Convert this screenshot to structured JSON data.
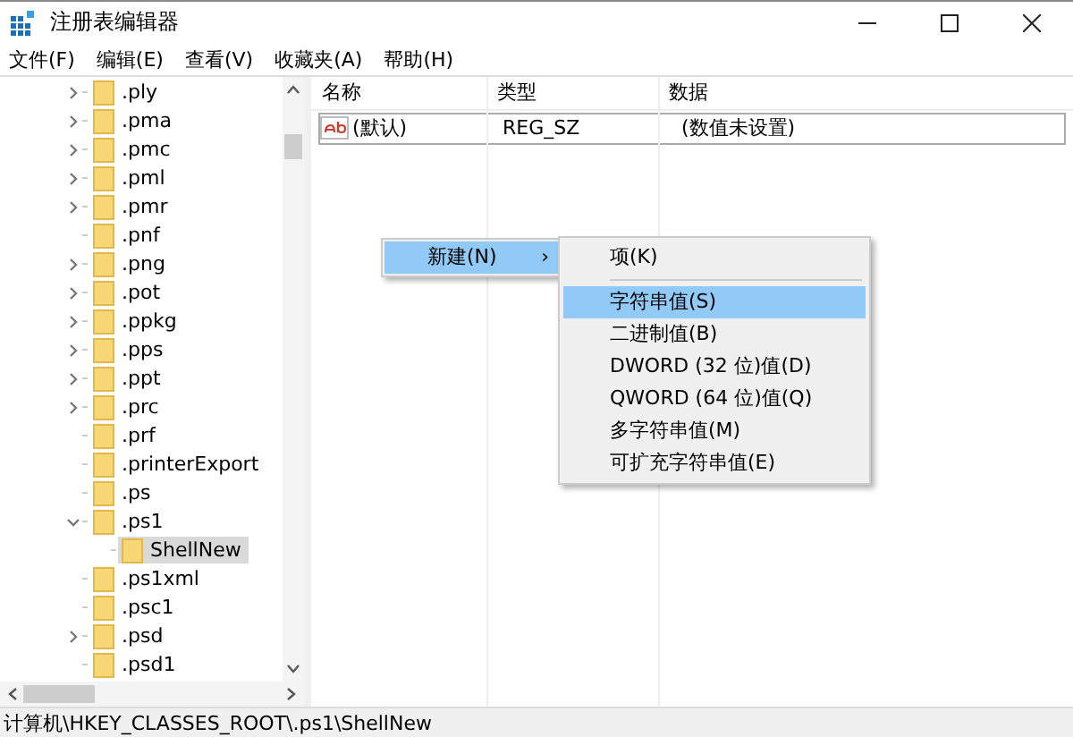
{
  "window": {
    "title": "注册表编辑器"
  },
  "menu": [
    {
      "label": "文件(F)"
    },
    {
      "label": "编辑(E)"
    },
    {
      "label": "查看(V)"
    },
    {
      "label": "收藏夹(A)"
    },
    {
      "label": "帮助(H)"
    }
  ],
  "tree": [
    {
      "label": ".ply",
      "expandable": true,
      "expanded": false,
      "selected": false
    },
    {
      "label": ".pma",
      "expandable": true,
      "expanded": false,
      "selected": false
    },
    {
      "label": ".pmc",
      "expandable": true,
      "expanded": false,
      "selected": false
    },
    {
      "label": ".pml",
      "expandable": true,
      "expanded": false,
      "selected": false
    },
    {
      "label": ".pmr",
      "expandable": true,
      "expanded": false,
      "selected": false
    },
    {
      "label": ".pnf",
      "expandable": false,
      "expanded": false,
      "selected": false
    },
    {
      "label": ".png",
      "expandable": true,
      "expanded": false,
      "selected": false
    },
    {
      "label": ".pot",
      "expandable": true,
      "expanded": false,
      "selected": false
    },
    {
      "label": ".ppkg",
      "expandable": true,
      "expanded": false,
      "selected": false
    },
    {
      "label": ".pps",
      "expandable": true,
      "expanded": false,
      "selected": false
    },
    {
      "label": ".ppt",
      "expandable": true,
      "expanded": false,
      "selected": false
    },
    {
      "label": ".prc",
      "expandable": true,
      "expanded": false,
      "selected": false
    },
    {
      "label": ".prf",
      "expandable": false,
      "expanded": false,
      "selected": false
    },
    {
      "label": ".printerExport",
      "expandable": false,
      "expanded": false,
      "selected": false
    },
    {
      "label": ".ps",
      "expandable": false,
      "expanded": false,
      "selected": false
    },
    {
      "label": ".ps1",
      "expandable": true,
      "expanded": true,
      "selected": false,
      "children": [
        {
          "label": "ShellNew",
          "expandable": false,
          "expanded": false,
          "selected": true
        }
      ]
    },
    {
      "label": ".ps1xml",
      "expandable": false,
      "expanded": false,
      "selected": false
    },
    {
      "label": ".psc1",
      "expandable": false,
      "expanded": false,
      "selected": false
    },
    {
      "label": ".psd",
      "expandable": true,
      "expanded": false,
      "selected": false
    },
    {
      "label": ".psd1",
      "expandable": false,
      "expanded": false,
      "selected": false
    }
  ],
  "table": {
    "columns": [
      "名称",
      "类型",
      "数据"
    ],
    "rows": [
      {
        "name": "(默认)",
        "type": "REG_SZ",
        "data": "(数值未设置)",
        "selected": true
      }
    ]
  },
  "context_menu": {
    "items": [
      {
        "label": "新建(N)",
        "submenu_arrow": "›",
        "selected": true
      }
    ]
  },
  "submenu": {
    "items": [
      {
        "kind": "item",
        "label": "项(K)",
        "selected": false
      },
      {
        "kind": "separator"
      },
      {
        "kind": "item",
        "label": "字符串值(S)",
        "selected": true
      },
      {
        "kind": "item",
        "label": "二进制值(B)",
        "selected": false
      },
      {
        "kind": "item",
        "label": "DWORD (32 位)值(D)",
        "selected": false
      },
      {
        "kind": "item",
        "label": "QWORD (64 位)值(Q)",
        "selected": false
      },
      {
        "kind": "item",
        "label": "多字符串值(M)",
        "selected": false
      },
      {
        "kind": "item",
        "label": "可扩充字符串值(E)",
        "selected": false
      }
    ]
  },
  "status_bar": {
    "path": "计算机\\HKEY_CLASSES_ROOT\\.ps1\\ShellNew"
  }
}
